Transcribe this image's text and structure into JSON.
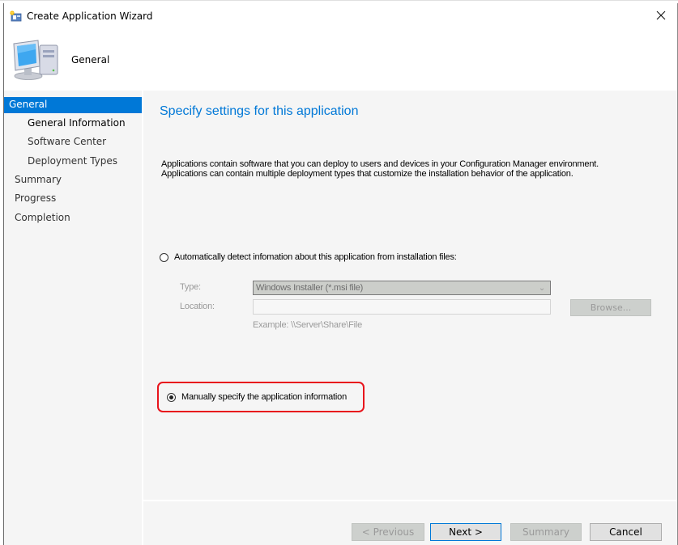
{
  "window": {
    "title": "Create Application Wizard",
    "close_icon": "close-icon",
    "app_icon": "wizard-app-icon"
  },
  "header": {
    "title": "General",
    "icon": "computer-icon"
  },
  "sidebar": {
    "items": [
      {
        "label": "General",
        "level": 0,
        "state": "active"
      },
      {
        "label": "General Information",
        "level": 1,
        "state": "current"
      },
      {
        "label": "Software Center",
        "level": 1,
        "state": "normal"
      },
      {
        "label": "Deployment Types",
        "level": 1,
        "state": "normal"
      },
      {
        "label": "Summary",
        "level": 0,
        "state": "normal"
      },
      {
        "label": "Progress",
        "level": 0,
        "state": "normal"
      },
      {
        "label": "Completion",
        "level": 0,
        "state": "normal"
      }
    ]
  },
  "main": {
    "title": "Specify settings for this application",
    "description_line1": "Applications contain software that you can deploy to users and devices in your Configuration Manager environment.",
    "description_line2": "Applications can contain multiple deployment types that customize the installation behavior of the application.",
    "auto_detect": {
      "label": "Automatically detect infomation about this application from installation files:",
      "checked": false,
      "type_label": "Type:",
      "type_value": "Windows Installer (*.msi file)",
      "location_label": "Location:",
      "location_value": "",
      "browse_label": "Browse...",
      "example_text": "Example: \\\\Server\\Share\\File",
      "enabled": false
    },
    "manual": {
      "label": "Manually specify the application information",
      "checked": true
    }
  },
  "footer": {
    "previous_label": "< Previous",
    "next_label": "Next >",
    "summary_label": "Summary",
    "cancel_label": "Cancel"
  },
  "colors": {
    "accent": "#0078d7",
    "highlight_border": "#e8141c",
    "panel_bg": "#f5f5f5"
  }
}
